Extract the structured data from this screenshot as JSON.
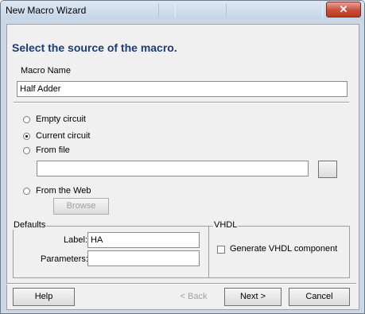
{
  "window": {
    "title": "New Macro Wizard",
    "close_glyph": "✕"
  },
  "page": {
    "heading": "Select the source of the macro."
  },
  "macro_name": {
    "label": "Macro Name",
    "value": "Half Adder"
  },
  "source": {
    "options": [
      {
        "label": "Empty circuit",
        "selected": false
      },
      {
        "label": "Current circuit",
        "selected": true
      },
      {
        "label": "From file",
        "selected": false
      },
      {
        "label": "From the Web",
        "selected": false
      }
    ],
    "file_path": "",
    "browse_label": "Browse"
  },
  "defaults": {
    "title": "Defaults",
    "label_label": "Label:",
    "label_value": "HA",
    "parameters_label": "Parameters:",
    "parameters_value": ""
  },
  "vhdl": {
    "title": "VHDL",
    "generate_label": "Generate VHDL component",
    "generate_checked": false
  },
  "buttons": {
    "help": "Help",
    "back": "< Back",
    "next": "Next >",
    "cancel": "Cancel"
  }
}
